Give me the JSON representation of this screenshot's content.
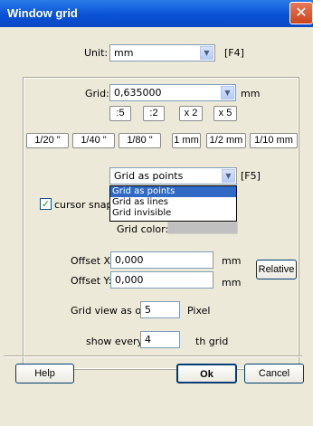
{
  "window": {
    "title": "Window grid",
    "close_glyph": "✕"
  },
  "unit": {
    "label": "Unit:",
    "value": "mm",
    "hotkey": "[F4]"
  },
  "grid": {
    "label": "Grid:",
    "value": "0,635000",
    "unit": "mm",
    "factor_buttons": [
      ":5",
      ":2",
      "x 2",
      "x 5"
    ],
    "preset_buttons": [
      "1/20 \"",
      "1/40 \"",
      "1/80 \"",
      "1 mm",
      "1/2 mm",
      "1/10 mm"
    ]
  },
  "grid_mode": {
    "value": "Grid as points",
    "hotkey": "[F5]",
    "options": [
      "Grid as points",
      "Grid as lines",
      "Grid invisible"
    ],
    "selected_index": 0
  },
  "cursor_snaps": {
    "label": "cursor snaps",
    "checked": true
  },
  "grid_color": {
    "label": "Grid color:",
    "color": "#c0c0c0"
  },
  "offset_x": {
    "label": "Offset X:",
    "value": "0,000",
    "unit": "mm"
  },
  "offset_y": {
    "label": "Offset Y:",
    "value": "0,000",
    "unit": "mm"
  },
  "relative_button": "Relative",
  "grid_view": {
    "label": "Grid view as of",
    "value": "5",
    "unit": "Pixel"
  },
  "show_every": {
    "label": "show every",
    "value": "4",
    "unit": "th grid"
  },
  "footer": {
    "help": "Help",
    "ok": "Ok",
    "cancel": "Cancel"
  }
}
